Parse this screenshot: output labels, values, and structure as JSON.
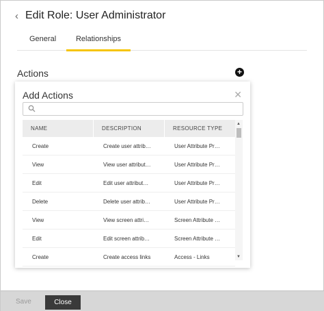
{
  "header": {
    "back_icon": "chevron-left-icon",
    "title": "Edit Role: User Administrator"
  },
  "tabs": [
    {
      "label": "General",
      "active": false
    },
    {
      "label": "Relationships",
      "active": true
    }
  ],
  "section": {
    "label": "Actions",
    "add_icon": "plus-circle-icon"
  },
  "popup": {
    "title": "Add Actions",
    "close_icon": "close-icon",
    "search": {
      "placeholder": "",
      "value": "",
      "icon": "search-icon"
    },
    "columns": [
      "NAME",
      "DESCRIPTION",
      "RESOURCE TYPE"
    ],
    "rows": [
      [
        "Create",
        "Create user attrib…",
        "User Attribute Pr…"
      ],
      [
        "View",
        "View user attribut…",
        "User Attribute Pr…"
      ],
      [
        "Edit",
        "Edit user attribut…",
        "User Attribute Pr…"
      ],
      [
        "Delete",
        "Delete user attrib…",
        "User Attribute Pr…"
      ],
      [
        "View",
        "View screen attri…",
        "Screen Attribute …"
      ],
      [
        "Edit",
        "Edit screen attrib…",
        "Screen Attribute …"
      ],
      [
        "Create",
        "Create access links",
        "Access - Links"
      ]
    ]
  },
  "footer": {
    "save_label": "Save",
    "close_label": "Close"
  },
  "colors": {
    "accent": "#f6c400",
    "close_button_bg": "#3a3a3a",
    "footer_bg": "#d7d7d7"
  }
}
